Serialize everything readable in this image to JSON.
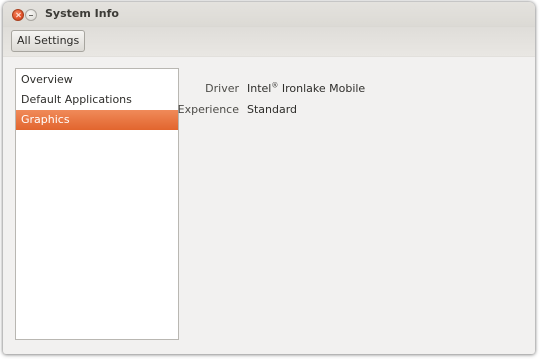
{
  "window": {
    "title": "System Info"
  },
  "toolbar": {
    "all_settings_label": "All Settings"
  },
  "sidebar": {
    "items": [
      {
        "label": "Overview",
        "selected": false
      },
      {
        "label": "Default Applications",
        "selected": false
      },
      {
        "label": "Graphics",
        "selected": true
      }
    ]
  },
  "graphics": {
    "driver": {
      "label": "Driver",
      "value_prefix": "Intel",
      "value_mark": "®",
      "value_suffix": " Ironlake Mobile"
    },
    "experience": {
      "label": "Experience",
      "value": "Standard"
    }
  },
  "colors": {
    "accent": "#e2652e",
    "close_button": "#e0512a",
    "window_background": "#f2f1f0"
  },
  "icons": {
    "close": "close-icon",
    "minimize": "minimize-icon"
  }
}
